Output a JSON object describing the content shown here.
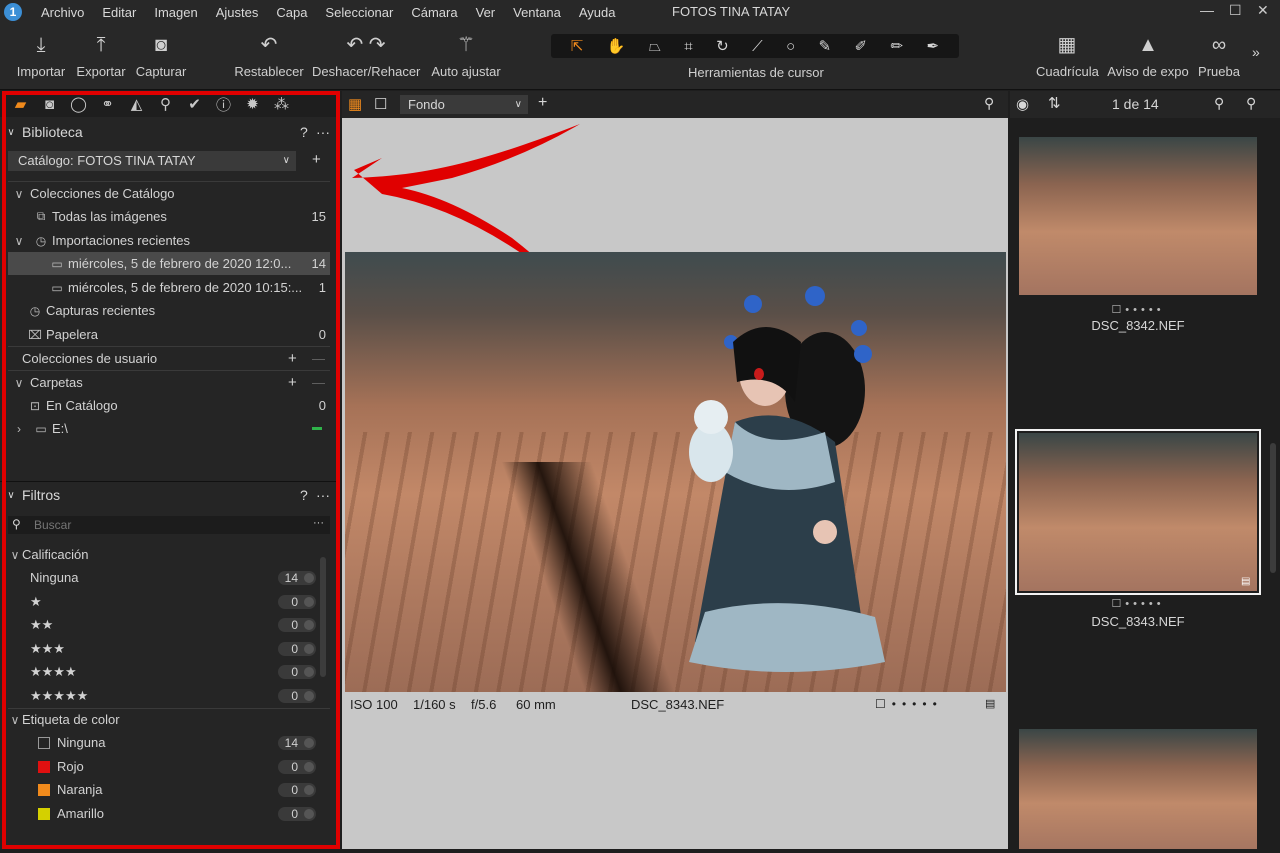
{
  "window": {
    "title": "FOTOS TINA TATAY"
  },
  "menu": [
    "Archivo",
    "Editar",
    "Imagen",
    "Ajustes",
    "Capa",
    "Seleccionar",
    "Cámara",
    "Ver",
    "Ventana",
    "Ayuda"
  ],
  "toolbar": {
    "import": "Importar",
    "export": "Exportar",
    "capture": "Capturar",
    "reset": "Restablecer",
    "undo_redo": "Deshacer/Rehacer",
    "auto": "Auto ajustar",
    "cursor_tools": "Herramientas de cursor",
    "grid": "Cuadrícula",
    "exposure": "Aviso de expo",
    "proof": "Prueba"
  },
  "library": {
    "title": "Biblioteca",
    "help": "?",
    "more": "···",
    "catalog": "Catálogo: FOTOS TINA TATAY",
    "catalog_collections": "Colecciones de Catálogo",
    "all_images": {
      "label": "Todas las imágenes",
      "count": "15"
    },
    "recent_imports": "Importaciones recientes",
    "import1": {
      "label": "miércoles, 5 de febrero de 2020 12:0...",
      "count": "14"
    },
    "import2": {
      "label": "miércoles, 5 de febrero de 2020 10:15:...",
      "count": "1"
    },
    "recent_captures": "Capturas recientes",
    "trash": {
      "label": "Papelera",
      "count": "0"
    },
    "user_collections": "Colecciones de usuario",
    "folders": "Carpetas",
    "in_catalog": {
      "label": "En Catálogo",
      "count": "0"
    },
    "drive": "E:\\"
  },
  "filters": {
    "title": "Filtros",
    "help": "?",
    "more": "···",
    "search_placeholder": "Buscar",
    "rating_title": "Calificación",
    "ratings": [
      {
        "label": "Ninguna",
        "count": "14"
      },
      {
        "label": "★",
        "count": "0"
      },
      {
        "label": "★★",
        "count": "0"
      },
      {
        "label": "★★★",
        "count": "0"
      },
      {
        "label": "★★★★",
        "count": "0"
      },
      {
        "label": "★★★★★",
        "count": "0"
      }
    ],
    "color_title": "Etiqueta de color",
    "colors": [
      {
        "label": "Ninguna",
        "count": "14",
        "color": "#252525"
      },
      {
        "label": "Rojo",
        "count": "0",
        "color": "#e01010"
      },
      {
        "label": "Naranja",
        "count": "0",
        "color": "#f08a1c"
      },
      {
        "label": "Amarillo",
        "count": "0",
        "color": "#d4d000"
      }
    ]
  },
  "viewer": {
    "background": "Fondo",
    "iso": "ISO 100",
    "shutter": "1/160 s",
    "aperture": "f/5.6",
    "focal": "60 mm",
    "filename": "DSC_8343.NEF"
  },
  "browser": {
    "counter": "1 de 14",
    "thumbs": [
      "DSC_8342.NEF",
      "DSC_8343.NEF"
    ]
  },
  "accent": "#f08a1c"
}
